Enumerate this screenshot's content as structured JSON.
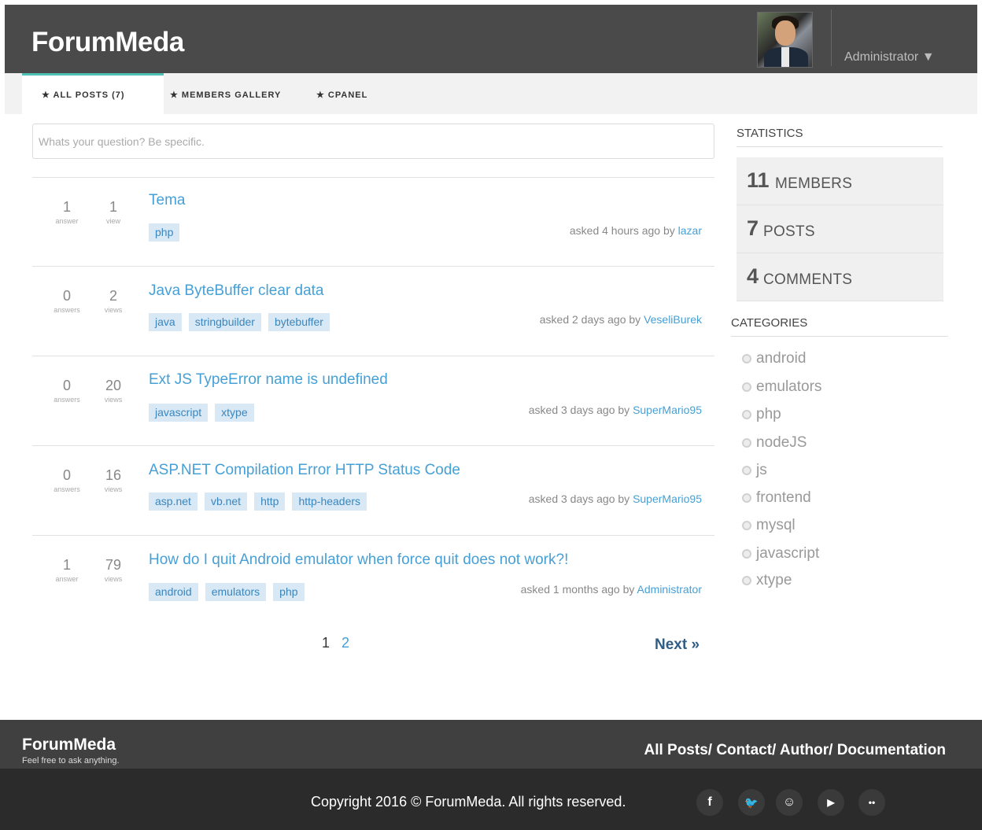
{
  "header": {
    "brand": "ForumMeda",
    "user_menu": "Administrator ▼"
  },
  "nav": {
    "items": [
      {
        "label": "★ ALL POSTS (7)"
      },
      {
        "label": "★ MEMBERS GALLERY"
      },
      {
        "label": "★ CPANEL"
      }
    ]
  },
  "question": {
    "placeholder": "Whats your question? Be specific."
  },
  "posts": [
    {
      "answers": "1",
      "answers_label": "answer",
      "views": "1",
      "views_label": "view",
      "title": "Tema",
      "tags": [
        "php"
      ],
      "meta": "asked 4 hours ago by",
      "author": "lazar"
    },
    {
      "answers": "0",
      "answers_label": "answers",
      "views": "2",
      "views_label": "views",
      "title": "Java ByteBuffer clear data",
      "tags": [
        "java",
        "stringbuilder",
        "bytebuffer"
      ],
      "meta": "asked 2 days ago by",
      "author": "VeseliBurek"
    },
    {
      "answers": "0",
      "answers_label": "answers",
      "views": "20",
      "views_label": "views",
      "title": "Ext JS TypeError name is undefined",
      "tags": [
        "javascript",
        "xtype"
      ],
      "meta": "asked 3 days ago by",
      "author": "SuperMario95"
    },
    {
      "answers": "0",
      "answers_label": "answers",
      "views": "16",
      "views_label": "views",
      "title": "ASP.NET Compilation Error HTTP Status Code",
      "tags": [
        "asp.net",
        "vb.net",
        "http",
        "http-headers"
      ],
      "meta": "asked 3 days ago by",
      "author": "SuperMario95"
    },
    {
      "answers": "1",
      "answers_label": "answer",
      "views": "79",
      "views_label": "views",
      "title": "How do I quit Android emulator when force quit does not work?!",
      "tags": [
        "android",
        "emulators",
        "php"
      ],
      "meta": "asked 1 months ago by",
      "author": "Administrator"
    }
  ],
  "pagination": {
    "pages": [
      "1",
      "2"
    ],
    "next": "Next »"
  },
  "sidebar": {
    "statistics_heading": "Statistics",
    "stats": [
      {
        "value": "11",
        "label": "Members"
      },
      {
        "value": "7",
        "label": "Posts"
      },
      {
        "value": "4",
        "label": "Comments"
      }
    ],
    "categories_heading": "Categories",
    "categories": [
      "android",
      "emulators",
      "php",
      "nodeJS",
      "js",
      "frontend",
      "mysql",
      "javascript",
      "xtype"
    ]
  },
  "footer": {
    "brand": "ForumMeda",
    "tagline": "Feel free to ask anything.",
    "links": "All Posts/ Contact/ Author/ Documentation",
    "copyright": "Copyright 2016 © ForumMeda. All rights reserved.",
    "social": [
      {
        "icon": "facebook-icon",
        "glyph": "f"
      },
      {
        "icon": "twitter-icon",
        "glyph": "🐦"
      },
      {
        "icon": "reddit-icon",
        "glyph": "☺"
      },
      {
        "icon": "youtube-icon",
        "glyph": "▶"
      },
      {
        "icon": "flickr-icon",
        "glyph": "••"
      }
    ]
  },
  "colors": {
    "header_bg": "#4a4a4a",
    "accent": "#4fc1b5",
    "link": "#46a0d6",
    "tag_bg": "#d8e8f5",
    "footer_top": "#404040",
    "footer_bottom": "#2b2b2b"
  }
}
